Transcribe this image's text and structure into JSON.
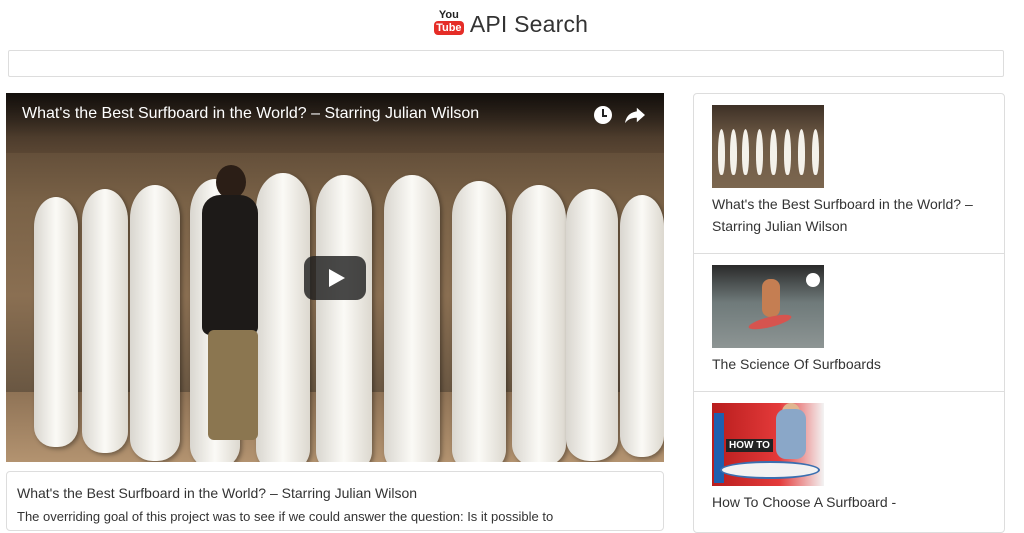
{
  "header": {
    "logo": {
      "you": "You",
      "tube": "Tube",
      "icon": "youtube-logo-icon"
    },
    "title": "API Search"
  },
  "search": {
    "value": "",
    "placeholder": ""
  },
  "player": {
    "title": "What's the Best Surfboard in the World? – Starring Julian Wilson",
    "icons": [
      "watch-later-icon",
      "share-icon",
      "play-icon"
    ]
  },
  "description": {
    "title": "What's the Best Surfboard in the World? – Starring Julian Wilson",
    "text": "The overriding goal of this project was to see if we could answer the question: Is it possible to"
  },
  "results": [
    {
      "label": "What's the Best Surfboard in the World? – Starring Julian Wilson"
    },
    {
      "label": "The Science Of Surfboards"
    },
    {
      "label": "How To Choose A Surfboard -"
    }
  ],
  "colors": {
    "youtube_red": "#e52d27",
    "border": "#dddddd",
    "text": "#333333"
  }
}
